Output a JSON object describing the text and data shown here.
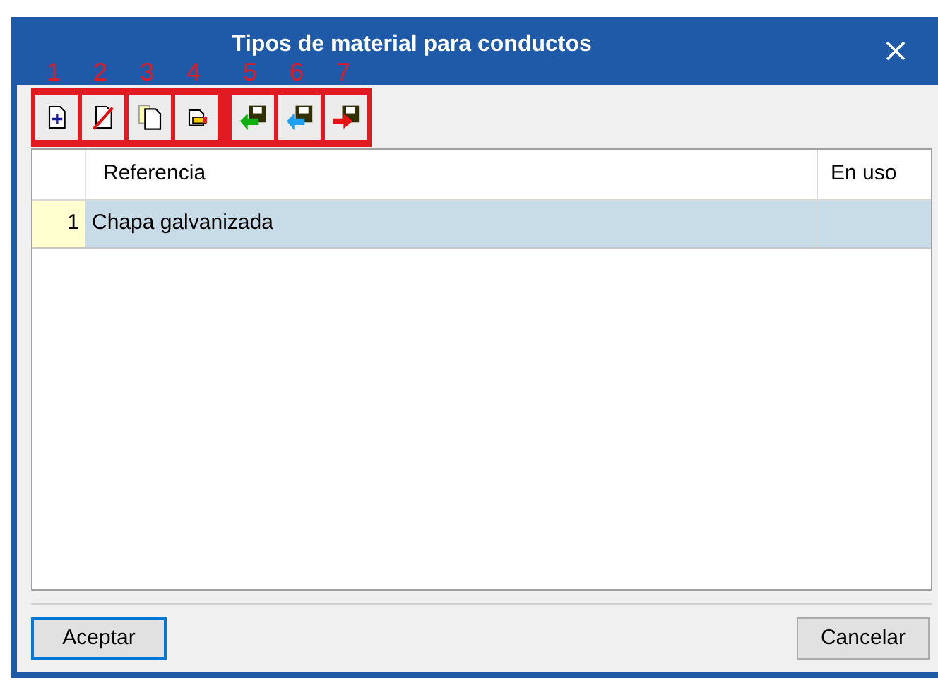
{
  "window": {
    "title": "Tipos de material para conductos"
  },
  "toolbar": [
    {
      "kind": "new",
      "callout": "1"
    },
    {
      "kind": "delete",
      "callout": "2"
    },
    {
      "kind": "copy",
      "callout": "3"
    },
    {
      "kind": "edit",
      "callout": "4"
    },
    {
      "kind": "import-green",
      "callout": "5"
    },
    {
      "kind": "import-blue",
      "callout": "6"
    },
    {
      "kind": "export",
      "callout": "7"
    }
  ],
  "table": {
    "columns": [
      "Referencia",
      "En uso"
    ],
    "rows": [
      {
        "number": "1",
        "referencia": "Chapa galvanizada",
        "selected": true
      }
    ]
  },
  "buttons": [
    {
      "label": "Aceptar",
      "default": true
    },
    {
      "label": "Cancelar",
      "default": false
    }
  ]
}
